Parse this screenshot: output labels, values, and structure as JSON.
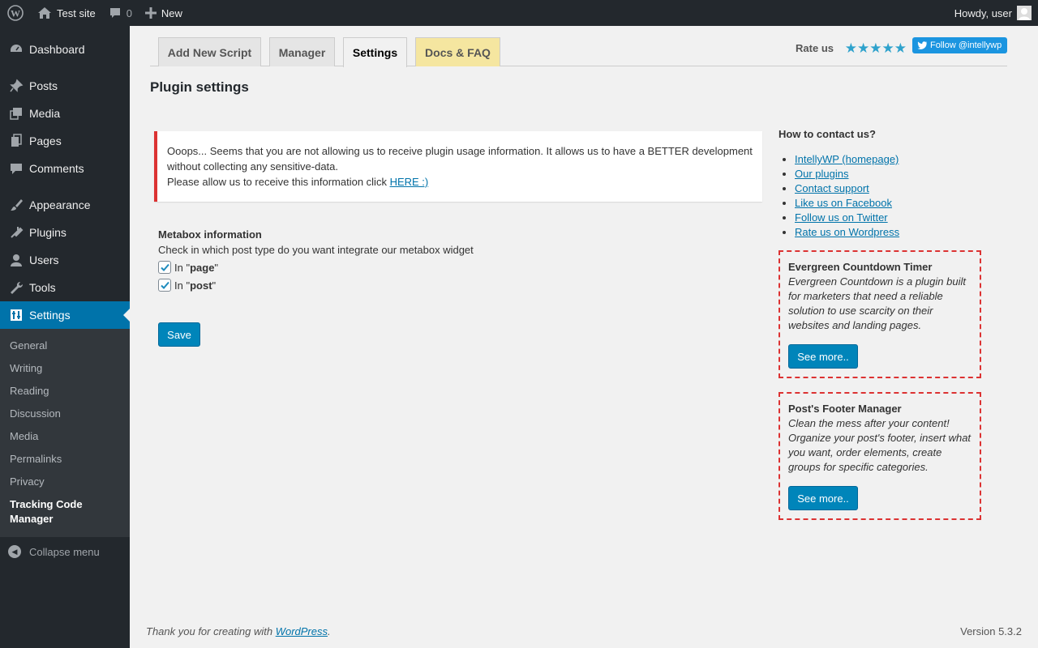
{
  "adminbar": {
    "site_name": "Test site",
    "comments_count": "0",
    "new_label": "New",
    "howdy": "Howdy, user"
  },
  "sidebar": {
    "items": [
      {
        "label": "Dashboard",
        "icon": "dashboard-icon"
      },
      {
        "label": "Posts",
        "icon": "pin-icon"
      },
      {
        "label": "Media",
        "icon": "media-icon"
      },
      {
        "label": "Pages",
        "icon": "pages-icon"
      },
      {
        "label": "Comments",
        "icon": "comment-icon"
      },
      {
        "label": "Appearance",
        "icon": "brush-icon"
      },
      {
        "label": "Plugins",
        "icon": "plug-icon"
      },
      {
        "label": "Users",
        "icon": "user-icon"
      },
      {
        "label": "Tools",
        "icon": "wrench-icon"
      },
      {
        "label": "Settings",
        "icon": "sliders-icon"
      }
    ],
    "submenu": [
      "General",
      "Writing",
      "Reading",
      "Discussion",
      "Media",
      "Permalinks",
      "Privacy",
      "Tracking Code Manager"
    ],
    "collapse_label": "Collapse menu"
  },
  "tabs": [
    "Add New Script",
    "Manager",
    "Settings",
    "Docs & FAQ"
  ],
  "rate_label": "Rate us",
  "follow_label": "Follow @intellywp",
  "page_title": "Plugin settings",
  "notice": {
    "line1": "Ooops... Seems that you are not allowing us to receive plugin usage information. It allows us to have a BETTER development without collecting any sensitive-data.",
    "line2_prefix": "Please allow us to receive this information click ",
    "link": "HERE :)"
  },
  "metabox": {
    "title": "Metabox information",
    "description": "Check in which post type do you want integrate our metabox widget",
    "options": [
      {
        "prefix": "In \"",
        "name": "page",
        "suffix": "\"",
        "checked": true
      },
      {
        "prefix": "In \"",
        "name": "post",
        "suffix": "\"",
        "checked": true
      }
    ]
  },
  "save_label": "Save",
  "contact": {
    "title": "How to contact us?",
    "links": [
      "IntellyWP (homepage)",
      "Our plugins",
      "Contact support",
      "Like us on Facebook",
      "Follow us on Twitter",
      "Rate us on Wordpress"
    ]
  },
  "promos": [
    {
      "title": "Evergreen Countdown Timer",
      "text": "Evergreen Countdown is a plugin built for marketers that need a reliable solution to use scarcity on their websites and landing pages.",
      "button": "See more.."
    },
    {
      "title": "Post's Footer Manager",
      "text": "Clean the mess after your content! Organize your post's footer, insert what you want, order elements, create groups for specific categories.",
      "button": "See more.."
    }
  ],
  "footer": {
    "thanks_prefix": "Thank you for creating with ",
    "thanks_link": "WordPress",
    "thanks_suffix": ".",
    "version": "Version 5.3.2"
  },
  "colors": {
    "accent": "#0073aa",
    "admin_dark": "#23282d",
    "notice_red": "#dc3232",
    "star_blue": "#2ea2cc"
  }
}
